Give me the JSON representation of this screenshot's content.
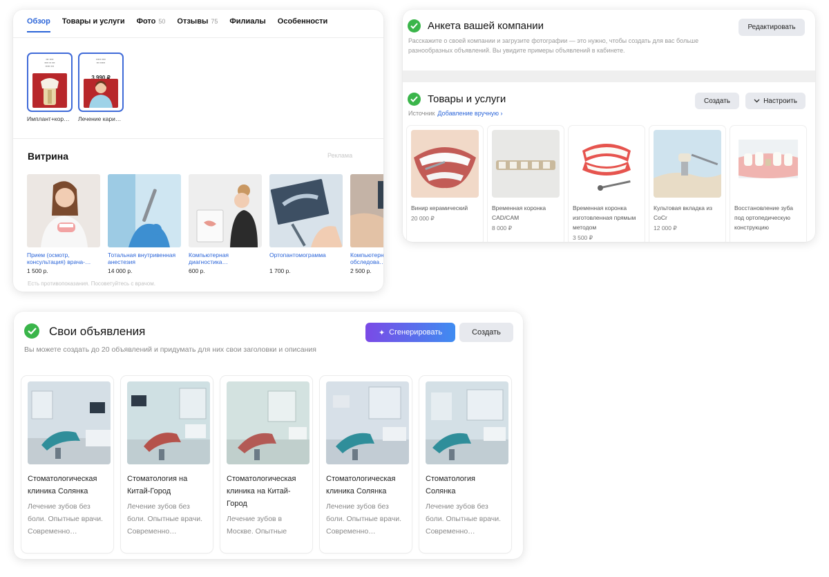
{
  "overview": {
    "tabs": [
      {
        "label": "Обзор",
        "count": ""
      },
      {
        "label": "Товары и услуги",
        "count": ""
      },
      {
        "label": "Фото",
        "count": "50"
      },
      {
        "label": "Отзывы",
        "count": "75"
      },
      {
        "label": "Филиалы",
        "count": ""
      },
      {
        "label": "Особенности",
        "count": ""
      }
    ],
    "promos": [
      {
        "caption": "Имплант+кор…",
        "price": ""
      },
      {
        "caption": "Лечение кари…",
        "price": "3 990 ₽"
      }
    ],
    "vitrina": {
      "title": "Витрина",
      "ad_label": "Реклама",
      "items": [
        {
          "name": "Прием (осмотр, консультация) врача-…",
          "price": "1 500 р."
        },
        {
          "name": "Тотальная внутривенная анестезия",
          "price": "14 000 р."
        },
        {
          "name": "Компьютерная диагностика…",
          "price": "600 р."
        },
        {
          "name": "Ортопантомограмма",
          "price": "1 700 р."
        },
        {
          "name": "Компьютерное обследова…",
          "price": "2 500 р."
        }
      ],
      "note": "Есть противопоказания. Посоветуйтесь с врачом."
    }
  },
  "company": {
    "title": "Анкета вашей компании",
    "description": "Расскажите о своей компании и загрузите фотографии — это нужно, чтобы создать для вас больше разнообразных объявлений. Вы увидите примеры объявлений в кабинете.",
    "edit_button": "Редактировать",
    "goods_title": "Товары и услуги",
    "source_label": "Источник",
    "source_link": "Добавление вручную",
    "create_button": "Создать",
    "configure_button": "Настроить",
    "goods": [
      {
        "name": "Винир керамический",
        "price": "20 000 ₽"
      },
      {
        "name": "Временная коронка CAD/CAM",
        "price": "8 000 ₽"
      },
      {
        "name": "Временная коронка изготовленная прямым методом",
        "price": "3 500 ₽"
      },
      {
        "name": "Культовая вкладка из CoCr",
        "price": "12 000 ₽"
      },
      {
        "name": "Восстановление зуба под ортопедическую конструкцию",
        "price": ""
      }
    ]
  },
  "ads": {
    "title": "Свои объявления",
    "description": "Вы можете создать до 20 объявлений и придумать для них свои заголовки и описания",
    "generate_button": "Сгенерировать",
    "create_button": "Создать",
    "items": [
      {
        "title": "Стоматологическая клиника Солянка",
        "text": "Лечение зубов без боли. Опытные врачи. Современно…"
      },
      {
        "title": "Стоматология на Китай-Город",
        "text": "Лечение зубов без боли. Опытные врачи. Современно…"
      },
      {
        "title": "Стоматологическая клиника на Китай-Город",
        "text": "Лечение зубов в Москве. Опытные врачи. Современно…"
      },
      {
        "title": "Стоматологическая клиника Солянка",
        "text": "Лечение зубов без боли. Опытные врачи. Современно…"
      },
      {
        "title": "Стоматология Солянка",
        "text": "Лечение зубов без боли. Опытные врачи. Современно…"
      }
    ]
  },
  "colors": {
    "accent": "#2a64d8",
    "success": "#3ab54a",
    "gen_from": "#7a4ae6",
    "gen_to": "#3f8cf1"
  }
}
